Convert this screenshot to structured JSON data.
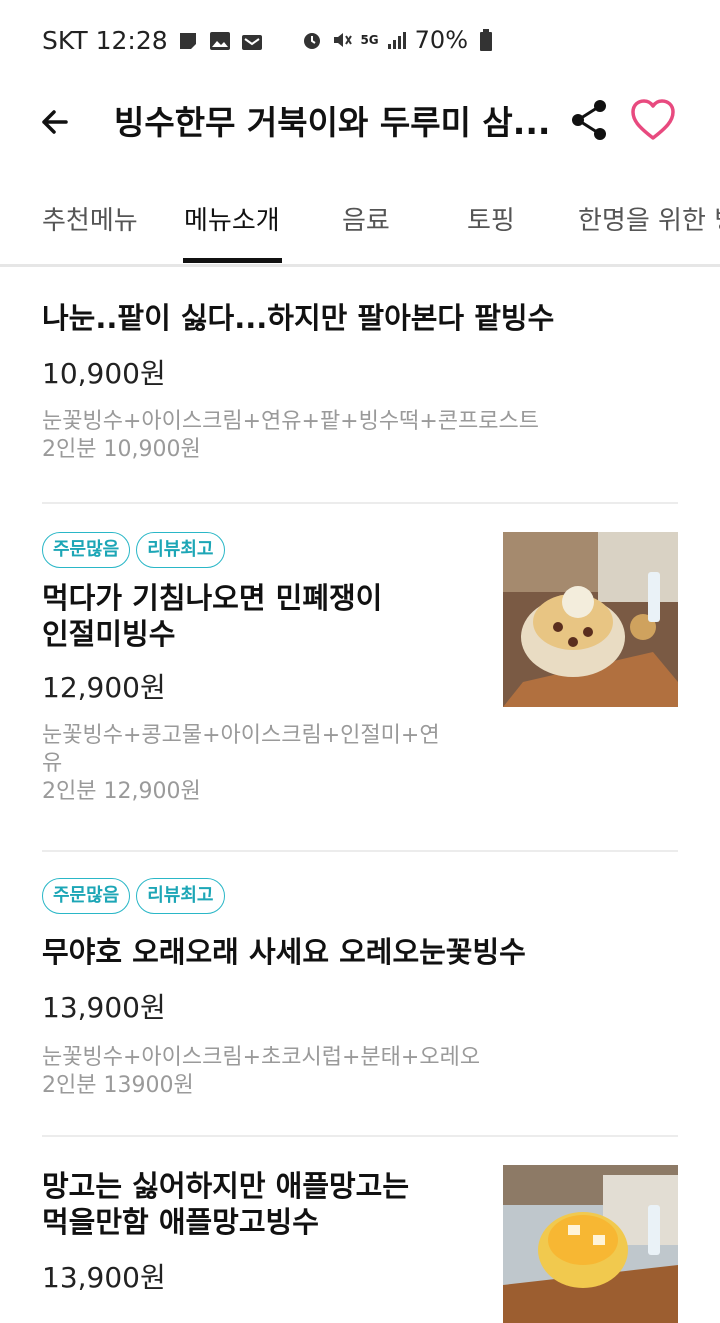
{
  "status_bar": {
    "carrier": "SKT",
    "time": "12:28",
    "network": "5G",
    "battery": "70%"
  },
  "header": {
    "title": "빙수한무 거북이와 두루미 삼..."
  },
  "tabs": [
    "추천메뉴",
    "메뉴소개",
    "음료",
    "토핑",
    "한명을 위한 빙"
  ],
  "active_tab": 1,
  "menu": [
    {
      "name": "나눈..팥이 싫다...하지만 팔아본다 팥빙수",
      "price": "10,900원",
      "desc": "눈꽃빙수+아이스크림+연유+팥+빙수떡+콘프로스트",
      "serving": "2인분 10,900원"
    },
    {
      "badges": [
        "주문많음",
        "리뷰최고"
      ],
      "name": "먹다가 기침나오면 민폐쟁이\n인절미빙수",
      "price": "12,900원",
      "desc": "눈꽃빙수+콩고물+아이스크림+인절미+연\n유",
      "serving": "2인분 12,900원"
    },
    {
      "badges": [
        "주문많음",
        "리뷰최고"
      ],
      "name": "무야호 오래오래 사세요 오레오눈꽃빙수",
      "price": "13,900원",
      "desc": "눈꽃빙수+아이스크림+초코시럽+분태+오레오",
      "serving": "2인분 13900원"
    },
    {
      "name": "망고는 싫어하지만 애플망고는\n먹을만함 애플망고빙수",
      "price": "13,900원"
    }
  ],
  "colors": {
    "accent": "#1ca6b6",
    "heart": "#e84a7f"
  }
}
